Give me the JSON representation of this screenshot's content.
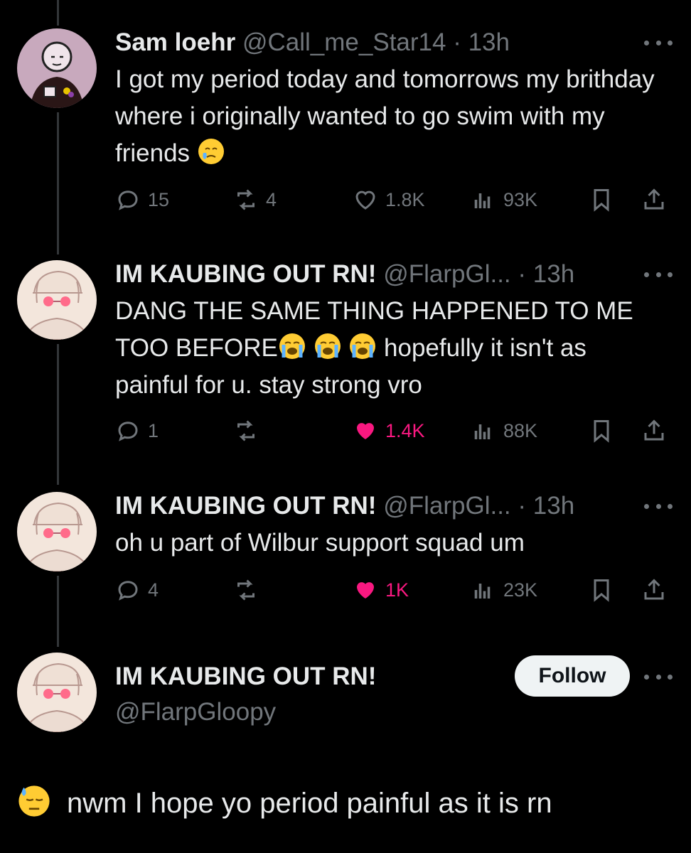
{
  "tweets": [
    {
      "name": "Sam loehr",
      "handle": "@Call_me_Star14",
      "dot": "·",
      "time": "13h",
      "text": "I got my period today and tomorrows my brithday where i originally wanted to go swim with my friends",
      "emoji": "face-holding-back-tears-emoji",
      "actions": {
        "replies": "15",
        "reposts": "4",
        "likes": "1.8K",
        "views": "93K",
        "liked": false
      }
    },
    {
      "name": "IM KAUBING OUT RN!",
      "handle": "@FlarpGl...",
      "dot": "·",
      "time": "13h",
      "text_a": "DANG THE SAME THING HAPPENED TO ME TOO BEFORE",
      "text_b": " hopefully it isn't as painful for u. stay strong vro",
      "emoji": "loudly-crying-face-emoji",
      "actions": {
        "replies": "1",
        "reposts": "",
        "likes": "1.4K",
        "views": "88K",
        "liked": true
      }
    },
    {
      "name": "IM KAUBING OUT RN!",
      "handle": "@FlarpGl...",
      "dot": "·",
      "time": "13h",
      "text": "oh u part of Wilbur support squad um",
      "actions": {
        "replies": "4",
        "reposts": "",
        "likes": "1K",
        "views": "23K",
        "liked": true
      }
    }
  ],
  "main_post": {
    "name": "IM KAUBING OUT RN!",
    "handle": "@FlarpGloopy",
    "follow_label": "Follow",
    "emoji": "downcast-face-with-sweat-emoji",
    "text": "nwm I hope yo period painful as it is rn"
  },
  "colors": {
    "background": "#000000",
    "text": "#e7e9ea",
    "muted": "#71767b",
    "like_active": "#f91880",
    "thread_line": "#333639",
    "follow_bg": "#eff3f4"
  },
  "icons": [
    "reply-icon",
    "repost-icon",
    "like-icon",
    "views-icon",
    "bookmark-icon",
    "share-icon",
    "more-icon"
  ]
}
